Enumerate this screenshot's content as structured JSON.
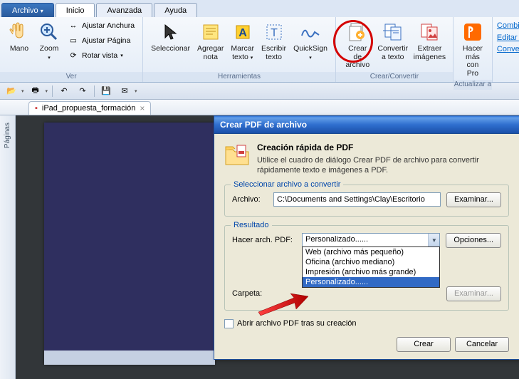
{
  "tabs": {
    "archivo": "Archivo",
    "inicio": "Inicio",
    "avanzada": "Avanzada",
    "ayuda": "Ayuda"
  },
  "ribbon": {
    "mano": "Mano",
    "zoom": "Zoom",
    "ajustar_anchura": "Ajustar Anchura",
    "ajustar_pagina": "Ajustar Página",
    "rotar_vista": "Rotar vista",
    "group_ver": "Ver",
    "seleccionar": "Seleccionar",
    "agregar_nota": "Agregar\nnota",
    "marcar_texto": "Marcar\ntexto",
    "escribir_texto": "Escribir\ntexto",
    "quicksign": "QuickSign",
    "group_herramientas": "Herramientas",
    "crear_de_archivo": "Crear de\narchivo",
    "convertir_a_texto": "Convertir\na texto",
    "extraer_imagenes": "Extraer\nimágenes",
    "group_crear": "Crear/Convertir",
    "hacer_mas": "Hacer más\ncon Pro",
    "group_actualizar": "Actualizar a",
    "link_combinar": "Combina",
    "link_editar": "Editar Te",
    "link_convertir": "Convertir"
  },
  "doc_tab": "iPad_propuesta_formación",
  "sidebar_label": "Páginas",
  "dialog": {
    "title": "Crear PDF de archivo",
    "hero_title": "Creación rápida de PDF",
    "hero_text": "Utilice el cuadro de diálogo Crear PDF de archivo para convertir rápidamente texto e imágenes a PDF.",
    "fs1_legend": "Seleccionar archivo a convertir",
    "archivo_label": "Archivo:",
    "archivo_value": "C:\\Documents and Settings\\Clay\\Escritorio",
    "examinar": "Examinar...",
    "fs2_legend": "Resultado",
    "hacer_label": "Hacer arch. PDF:",
    "hacer_selected": "Personalizado......",
    "opciones": "Opciones...",
    "carpeta_label": "Carpeta:",
    "examinar2": "Examinar...",
    "dd_items": [
      "Web (archivo más pequeño)",
      "Oficina (archivo mediano)",
      "Impresión (archivo más grande)",
      "Personalizado......"
    ],
    "check_label": "Abrir archivo PDF tras su creación",
    "btn_crear": "Crear",
    "btn_cancelar": "Cancelar"
  }
}
